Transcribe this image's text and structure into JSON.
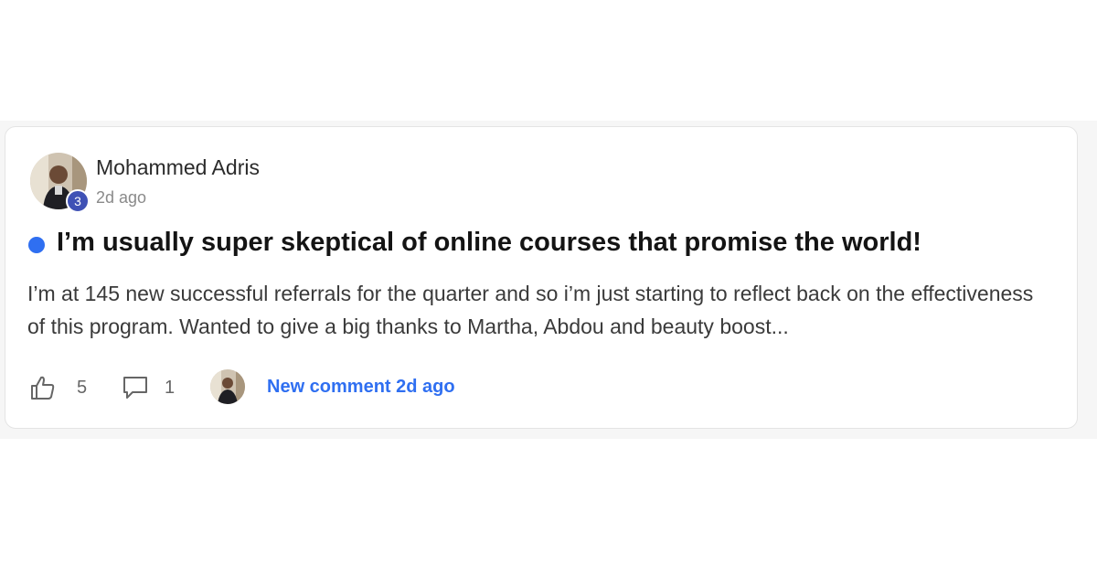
{
  "post": {
    "author": "Mohammed Adris",
    "author_level": "3",
    "posted_ago": "2d ago",
    "title": "I’m usually super skeptical of online courses that promise the world!",
    "excerpt": "I’m at 145 new successful referrals for the quarter and so i’m just starting to reflect back on the effectiveness of this program. Wanted to give a big thanks to Martha, Abdou and beauty boost...",
    "unread": true,
    "like_count": "5",
    "comment_count": "1",
    "latest_activity": "New comment 2d ago"
  },
  "icons": {
    "like": "thumbs-up-icon",
    "comment": "comment-bubble-icon",
    "unread": "unread-dot-icon"
  },
  "colors": {
    "accent_blue": "#2f6ff1",
    "level_badge": "#3f51b5",
    "card_border": "#e4e4e4",
    "background_band": "#f6f6f6"
  }
}
